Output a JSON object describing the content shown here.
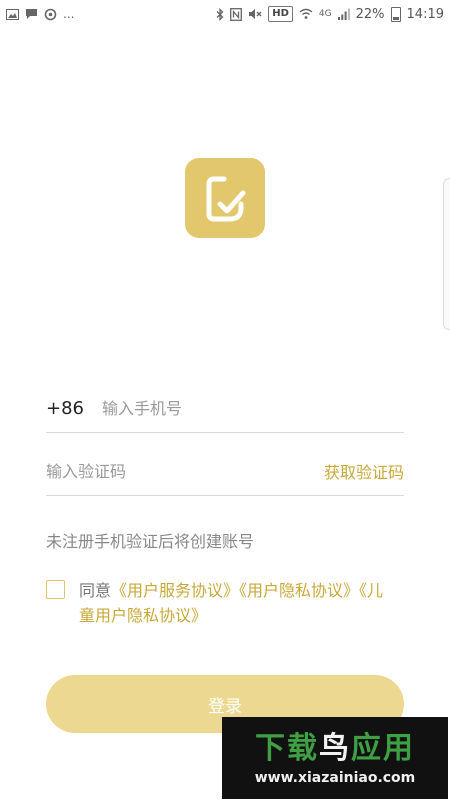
{
  "status_bar": {
    "more_dots": "...",
    "hd": "HD",
    "network": "4G",
    "battery_percent": "22%",
    "time": "14:19"
  },
  "login": {
    "country_code": "+86",
    "phone_placeholder": "输入手机号",
    "code_placeholder": "输入验证码",
    "get_code_label": "获取验证码",
    "hint": "未注册手机验证后将创建账号",
    "agree_prefix": "同意",
    "user_agreement": "《用户服务协议》",
    "privacy_policy": "《用户隐私协议》",
    "child_privacy": "《儿童用户隐私协议》",
    "login_label": "登录"
  },
  "watermark": {
    "title_part1": "下载",
    "title_part2": "鸟",
    "title_part3": "应用",
    "url": "www.xiazainiao.com"
  },
  "colors": {
    "accent": "#e3c76c",
    "accent_text": "#c9a838",
    "button": "#edd891"
  }
}
